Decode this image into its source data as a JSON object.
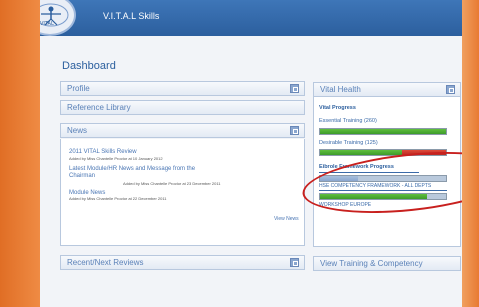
{
  "app": {
    "title": "V.I.T.A.L Skills",
    "logo_text": "VITAL"
  },
  "dashboard": {
    "title": "Dashboard"
  },
  "left_panels": {
    "profile": "Profile",
    "reference_library": "Reference Library",
    "news": "News",
    "recent_next_reviews": "Recent/Next Reviews"
  },
  "news": {
    "items": [
      {
        "title": "2011 VITAL Skills Review",
        "meta": "Added by Miss Chantelle Proctor at 10 January 2012"
      },
      {
        "title": "Latest Module/HR News and Message from the",
        "title2": "Chairman",
        "meta": "Added by Miss Chantelle Proctor at 23 December 2011"
      },
      {
        "title": "Module News",
        "meta": "Added by Miss Chantelle Proctor at 22 December 2011"
      }
    ],
    "view_label": "View News"
  },
  "vital_health": {
    "title": "Vital Health",
    "progress_title": "Vital Progress",
    "essential_label": "Essential Training (260)",
    "essential_progress": {
      "green": 1.0
    },
    "desirable_label": "Desirable Training (125)",
    "desirable_progress": {
      "green": 0.65,
      "red": 0.35
    },
    "framework_title": "Eibrole Framework Progress",
    "hse_label": "HSE COMPETENCY FRAMEWORK - ALL DEPTS",
    "hse_progress": {
      "green": 0.3
    },
    "workshop_label": "WORKSHOP EUROPE",
    "workshop_progress": {
      "green": 0.85
    }
  },
  "bottom_right": {
    "label": "View Training & Competency"
  },
  "colors": {
    "brand_blue": "#2c5f9e",
    "frame_orange": "#e8803a",
    "progress_green": "#3d9b2a",
    "progress_red": "#c8201e"
  }
}
